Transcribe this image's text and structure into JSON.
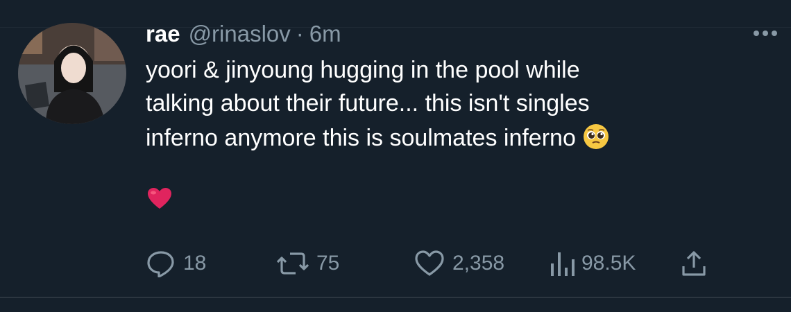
{
  "tweet": {
    "author_name": "rae",
    "handle": "@rinaslov",
    "separator": "·",
    "time": "6m",
    "text_lines": [
      "yoori & jinyoung hugging in the pool while",
      "talking about their future... this isn't singles",
      "inferno anymore this is soulmates inferno"
    ],
    "emojis": [
      "pleading-face-emoji",
      "red-heart-emoji"
    ]
  },
  "actions": {
    "replies": "18",
    "retweets": "75",
    "likes": "2,358",
    "views": "98.5K"
  },
  "colors": {
    "background": "#15202b",
    "text_primary": "#ffffff",
    "text_secondary": "#8899a6",
    "heart": "#e0245e"
  },
  "icons": [
    "more-icon",
    "reply-icon",
    "retweet-icon",
    "like-icon",
    "views-icon",
    "share-icon"
  ]
}
